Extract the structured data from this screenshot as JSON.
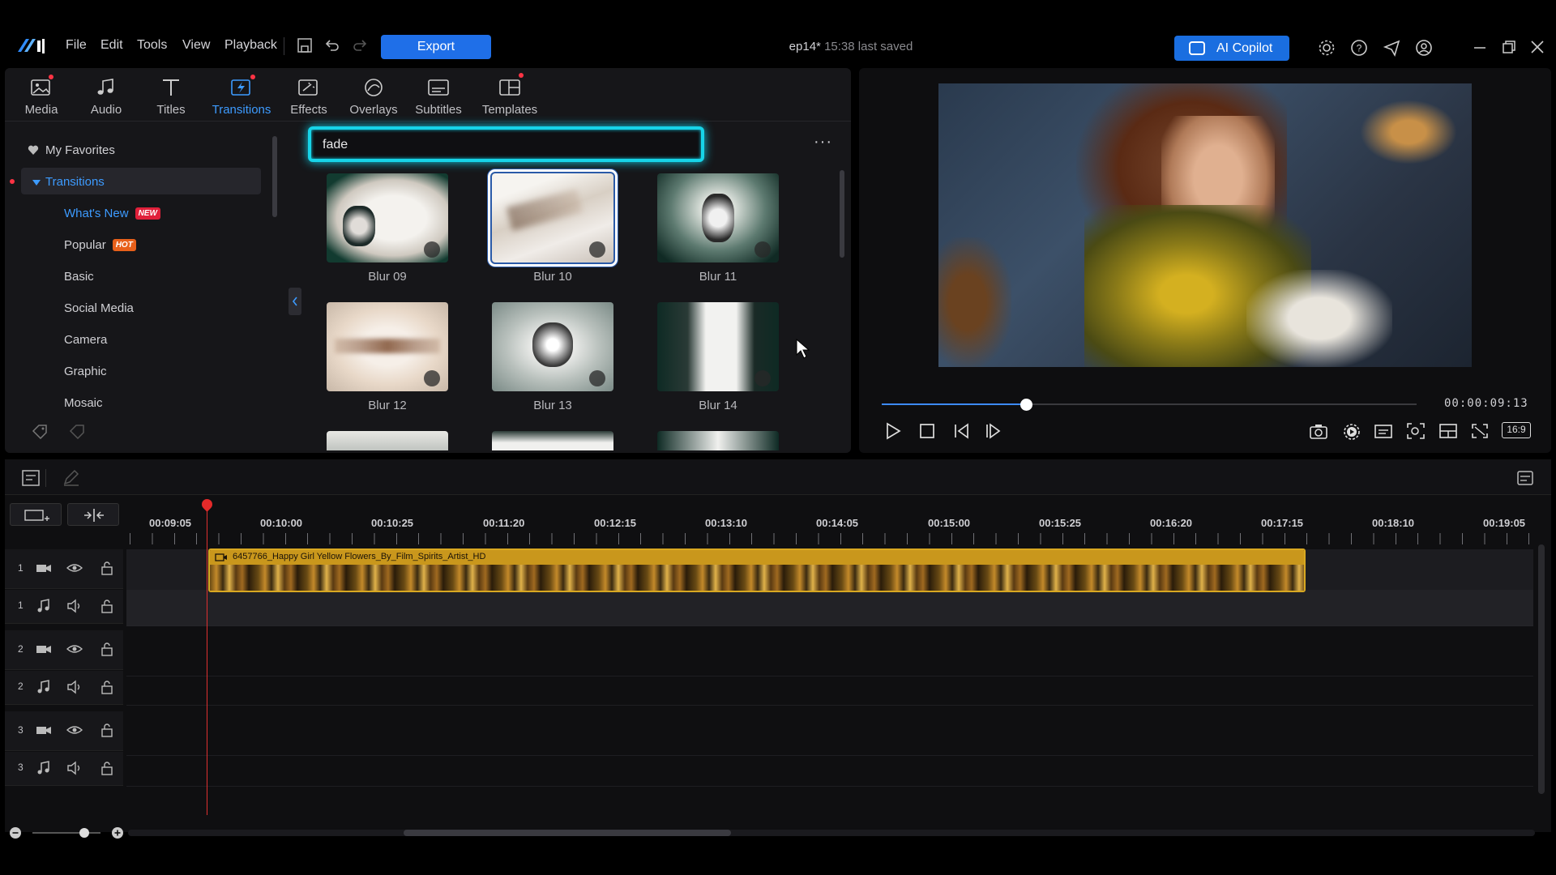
{
  "titlebar": {
    "menu": [
      "File",
      "Edit",
      "Tools",
      "View",
      "Playback"
    ],
    "export_label": "Export",
    "project_name": "ep14*",
    "project_saved": "15:38 last saved",
    "ai_copilot_label": "AI Copilot",
    "accent_color": "#1f6fe8"
  },
  "tabs": [
    {
      "label": "Media",
      "icon": "media-icon",
      "dot": true
    },
    {
      "label": "Audio",
      "icon": "music-note-icon",
      "dot": false
    },
    {
      "label": "Titles",
      "icon": "text-t-icon",
      "dot": false
    },
    {
      "label": "Transitions",
      "icon": "transitions-icon",
      "dot": true,
      "active": true
    },
    {
      "label": "Effects",
      "icon": "effects-icon",
      "dot": false
    },
    {
      "label": "Overlays",
      "icon": "overlays-icon",
      "dot": false
    },
    {
      "label": "Subtitles",
      "icon": "subtitles-icon",
      "dot": false
    },
    {
      "label": "Templates",
      "icon": "templates-icon",
      "dot": true
    }
  ],
  "sidebar": {
    "favorites": "My Favorites",
    "section": "Transitions",
    "items": [
      {
        "label": "What's New",
        "badge": "NEW"
      },
      {
        "label": "Popular",
        "badge": "HOT"
      },
      {
        "label": "Basic"
      },
      {
        "label": "Social Media"
      },
      {
        "label": "Camera"
      },
      {
        "label": "Graphic"
      },
      {
        "label": "Mosaic"
      }
    ]
  },
  "search": {
    "value": "fade"
  },
  "transitions_grid": [
    {
      "label": "Blur 09"
    },
    {
      "label": "Blur 10",
      "selected": true
    },
    {
      "label": "Blur 11"
    },
    {
      "label": "Blur 12"
    },
    {
      "label": "Blur 13"
    },
    {
      "label": "Blur 14"
    }
  ],
  "preview": {
    "timecode": "00:00:09:13",
    "progress": 0.27,
    "aspect": "16:9"
  },
  "timeline": {
    "ruler": [
      "00:09:05",
      "00:10:00",
      "00:10:25",
      "00:11:20",
      "00:12:15",
      "00:13:10",
      "00:14:05",
      "00:15:00",
      "00:15:25",
      "00:16:20",
      "00:17:15",
      "00:18:10",
      "00:19:05"
    ],
    "tracks": [
      {
        "num": "1",
        "type": "video"
      },
      {
        "num": "1",
        "type": "audio"
      },
      {
        "num": "2",
        "type": "video"
      },
      {
        "num": "2",
        "type": "audio"
      },
      {
        "num": "3",
        "type": "video"
      },
      {
        "num": "3",
        "type": "audio"
      }
    ],
    "clip_name": "6457766_Happy Girl Yellow Flowers_By_Film_Spirits_Artist_HD"
  }
}
